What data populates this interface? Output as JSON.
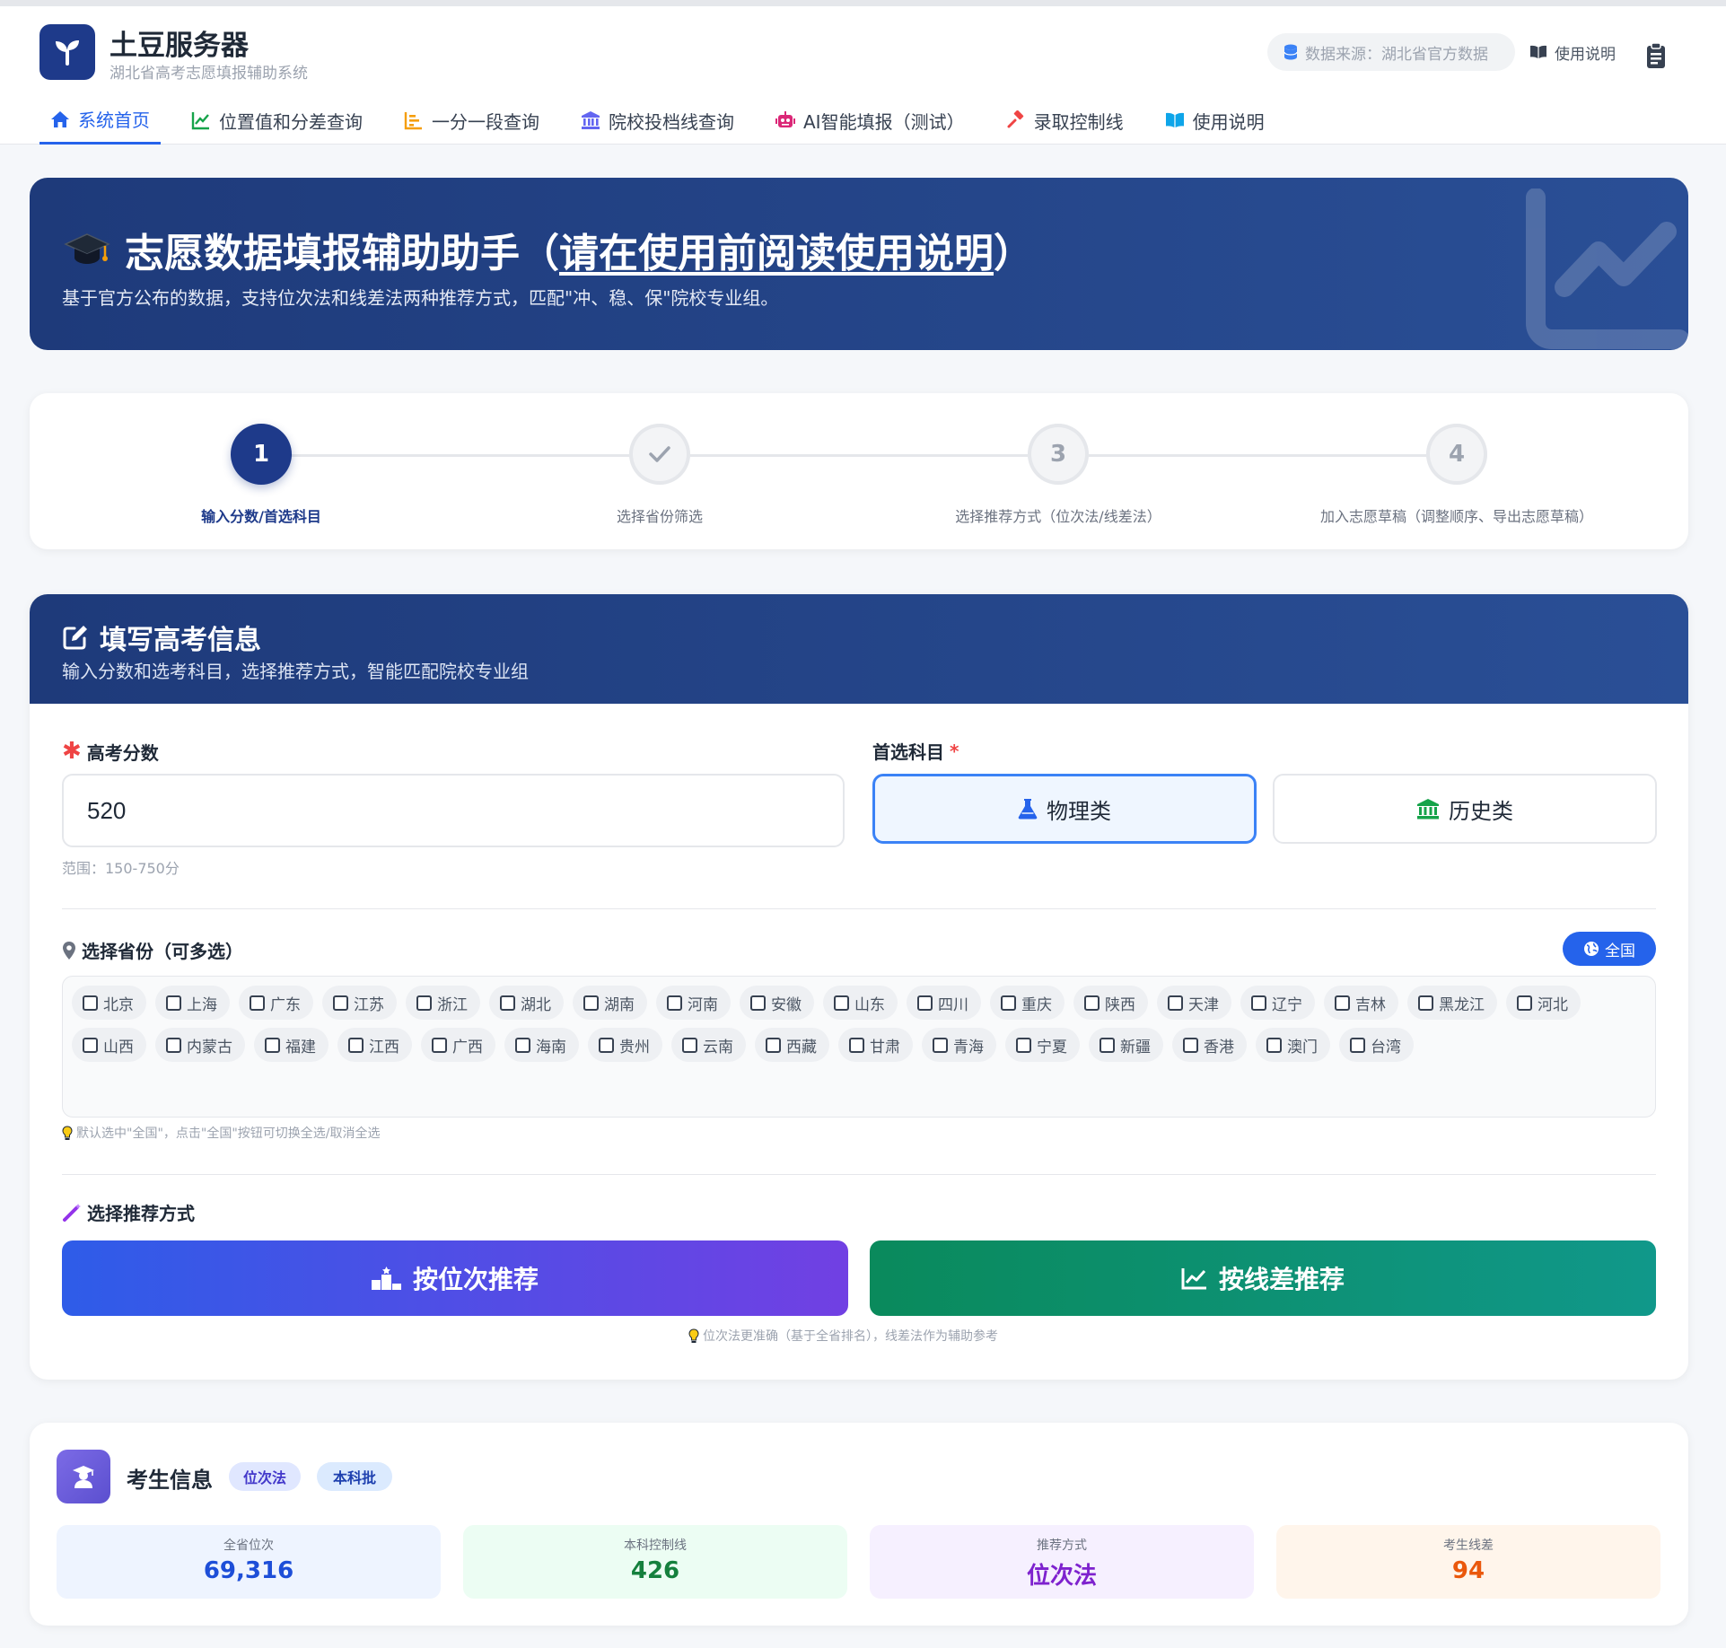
{
  "header": {
    "title": "土豆服务器",
    "subtitle": "湖北省高考志愿填报辅助系统",
    "source": "数据来源：湖北省官方数据",
    "help": "使用说明"
  },
  "nav": [
    {
      "label": "系统首页",
      "icon": "home-icon",
      "active": true
    },
    {
      "label": "位置值和分差查询",
      "icon": "line-chart-icon"
    },
    {
      "label": "一分一段查询",
      "icon": "bar-list-icon"
    },
    {
      "label": "院校投档线查询",
      "icon": "university-icon"
    },
    {
      "label": "AI智能填报（测试）",
      "icon": "robot-icon"
    },
    {
      "label": "录取控制线",
      "icon": "gavel-icon"
    },
    {
      "label": "使用说明",
      "icon": "book-icon"
    }
  ],
  "hero": {
    "title_prefix": "志愿数据填报辅助助手（",
    "title_link": "请在使用前阅读使用说明",
    "title_suffix": "）",
    "subtitle": "基于官方公布的数据，支持位次法和线差法两种推荐方式，匹配\"冲、稳、保\"院校专业组。"
  },
  "steps": [
    {
      "num": "1",
      "label": "输入分数/首选科目",
      "state": "active"
    },
    {
      "num": "✓",
      "label": "选择省份筛选",
      "state": "done"
    },
    {
      "num": "3",
      "label": "选择推荐方式（位次法/线差法）",
      "state": "todo"
    },
    {
      "num": "4",
      "label": "加入志愿草稿（调整顺序、导出志愿草稿）",
      "state": "todo"
    }
  ],
  "form": {
    "title": "填写高考信息",
    "subtitle": "输入分数和选考科目，选择推荐方式，智能匹配院校专业组",
    "score_label": "高考分数",
    "score_value": "520",
    "score_range": "范围：150-750分",
    "subject_label": "首选科目",
    "subjects": [
      {
        "label": "物理类",
        "selected": true
      },
      {
        "label": "历史类",
        "selected": false
      }
    ],
    "province_label": "选择省份（可多选）",
    "all_label": "全国",
    "provinces": [
      "北京",
      "上海",
      "广东",
      "江苏",
      "浙江",
      "湖北",
      "湖南",
      "河南",
      "安徽",
      "山东",
      "四川",
      "重庆",
      "陕西",
      "天津",
      "辽宁",
      "吉林",
      "黑龙江",
      "河北",
      "山西",
      "内蒙古",
      "福建",
      "江西",
      "广西",
      "海南",
      "贵州",
      "云南",
      "西藏",
      "甘肃",
      "青海",
      "宁夏",
      "新疆",
      "香港",
      "澳门",
      "台湾"
    ],
    "province_hint": "默认选中\"全国\"，点击\"全国\"按钮可切换全选/取消全选",
    "method_label": "选择推荐方式",
    "btn_rank": "按位次推荐",
    "btn_line": "按线差推荐",
    "method_hint": "位次法更准确（基于全省排名），线差法作为辅助参考"
  },
  "info": {
    "title": "考生信息",
    "badge_method": "位次法",
    "badge_batch": "本科批",
    "stats": [
      {
        "label": "全省位次",
        "value": "69,316",
        "color": "#1d4ed8",
        "bg": "#eef4ff"
      },
      {
        "label": "本科控制线",
        "value": "426",
        "color": "#15803d",
        "bg": "#ecfdf3"
      },
      {
        "label": "推荐方式",
        "value": "位次法",
        "color": "#7e22ce",
        "bg": "#f6f0ff"
      },
      {
        "label": "考生线差",
        "value": "94",
        "color": "#ea580c",
        "bg": "#fff5eb"
      }
    ]
  }
}
